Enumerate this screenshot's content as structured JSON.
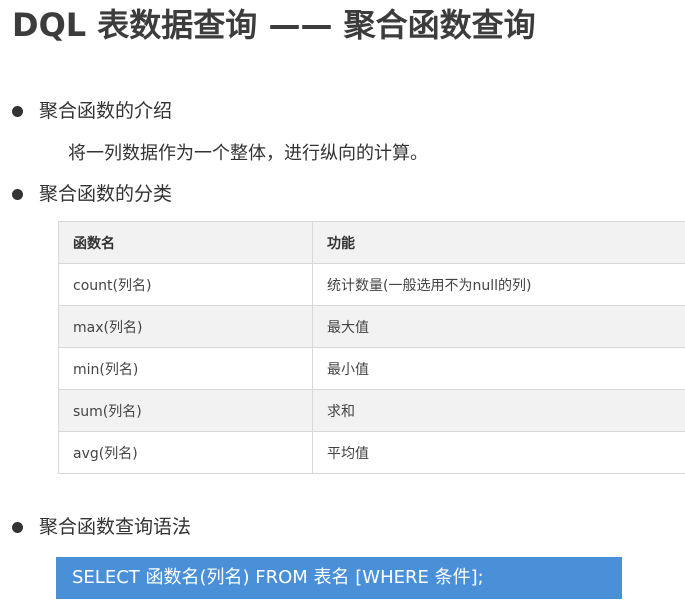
{
  "slide": {
    "title": "DQL 表数据查询 —— 聚合函数查询"
  },
  "sections": {
    "intro": {
      "heading": "聚合函数的介绍",
      "description": "将一列数据作为一个整体，进行纵向的计算。"
    },
    "categories": {
      "heading": "聚合函数的分类"
    },
    "syntax": {
      "heading": "聚合函数查询语法",
      "code": "SELECT 函数名(列名) FROM 表名 [WHERE 条件];"
    }
  },
  "table": {
    "headers": [
      "函数名",
      "功能"
    ],
    "rows": [
      [
        "count(列名)",
        "统计数量(一般选用不为null的列)"
      ],
      [
        "max(列名)",
        "最大值"
      ],
      [
        "min(列名)",
        "最小值"
      ],
      [
        "sum(列名)",
        "求和"
      ],
      [
        "avg(列名)",
        "平均值"
      ]
    ]
  },
  "colors": {
    "code_background": "#4a90d9",
    "code_text": "#ffffff",
    "alt_row": "#f2f2f2"
  }
}
